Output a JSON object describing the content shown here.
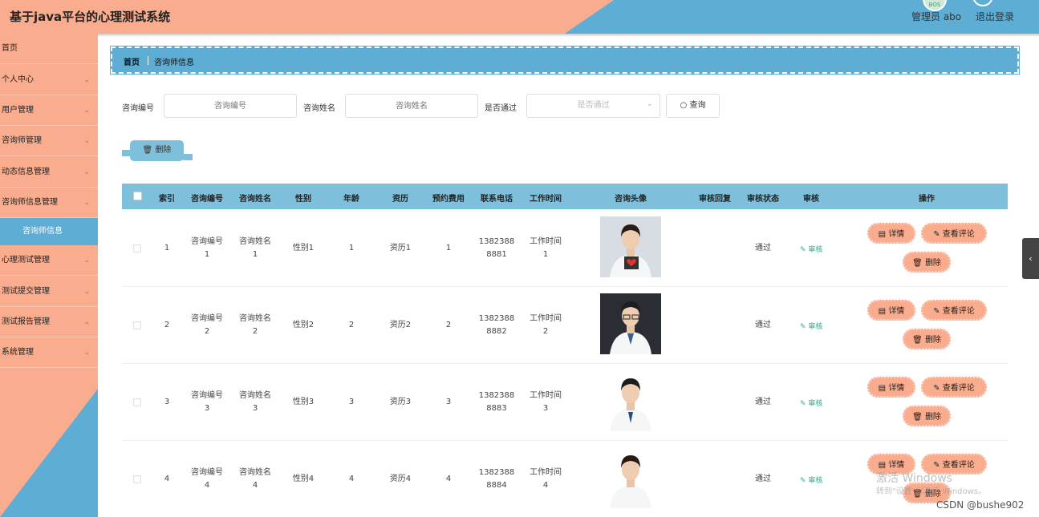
{
  "header": {
    "title": "基于java平台的心理测试系统",
    "avatar_text": "BOS",
    "user": "管理员 abo",
    "logout": "退出登录"
  },
  "sidebar": {
    "items": [
      {
        "label": "首页",
        "expandable": false
      },
      {
        "label": "个人中心",
        "expandable": true
      },
      {
        "label": "用户管理",
        "expandable": true
      },
      {
        "label": "咨询师管理",
        "expandable": true
      },
      {
        "label": "动态信息管理",
        "expandable": true
      },
      {
        "label": "咨询师信息管理",
        "expandable": true
      },
      {
        "label": "心理测试管理",
        "expandable": true
      },
      {
        "label": "测试提交管理",
        "expandable": true
      },
      {
        "label": "测试报告管理",
        "expandable": true
      },
      {
        "label": "系统管理",
        "expandable": true
      }
    ],
    "active_sub": "咨询师信息"
  },
  "breadcrumb": {
    "home": "首页",
    "current": "咨询师信息"
  },
  "search": {
    "code_label": "咨询编号",
    "code_placeholder": "咨询编号",
    "name_label": "咨询姓名",
    "name_placeholder": "咨询姓名",
    "pass_label": "是否通过",
    "pass_placeholder": "是否通过",
    "query_label": "查询"
  },
  "toolbar": {
    "delete_label": "删除"
  },
  "table": {
    "headers": [
      "索引",
      "咨询编号",
      "咨询姓名",
      "性别",
      "年龄",
      "资历",
      "预约费用",
      "联系电话",
      "工作时间",
      "咨询头像",
      "审核回复",
      "审核状态",
      "审核",
      "操作"
    ],
    "audit_label": "审核",
    "op_detail": "详情",
    "op_comments": "查看评论",
    "op_delete": "删除",
    "rows": [
      {
        "index": "1",
        "code": [
          "咨询编号",
          "1"
        ],
        "name": [
          "咨询姓名",
          "1"
        ],
        "gender": "性别1",
        "age": "1",
        "qualification": "资历1",
        "fee": "1",
        "phone": [
          "1382388",
          "8881"
        ],
        "worktime": [
          "工作时间",
          "1"
        ],
        "reply": "",
        "status": "通过",
        "avatar": "female-doctor-tablet"
      },
      {
        "index": "2",
        "code": [
          "咨询编号",
          "2"
        ],
        "name": [
          "咨询姓名",
          "2"
        ],
        "gender": "性别2",
        "age": "2",
        "qualification": "资历2",
        "fee": "2",
        "phone": [
          "1382388",
          "8882"
        ],
        "worktime": [
          "工作时间",
          "2"
        ],
        "reply": "",
        "status": "通过",
        "avatar": "male-doctor-glasses"
      },
      {
        "index": "3",
        "code": [
          "咨询编号",
          "3"
        ],
        "name": [
          "咨询姓名",
          "3"
        ],
        "gender": "性别3",
        "age": "3",
        "qualification": "资历3",
        "fee": "3",
        "phone": [
          "1382388",
          "8883"
        ],
        "worktime": [
          "工作时间",
          "3"
        ],
        "reply": "",
        "status": "通过",
        "avatar": "male-doctor"
      },
      {
        "index": "4",
        "code": [
          "咨询编号",
          "4"
        ],
        "name": [
          "咨询姓名",
          "4"
        ],
        "gender": "性别4",
        "age": "4",
        "qualification": "资历4",
        "fee": "4",
        "phone": [
          "1382388",
          "8884"
        ],
        "worktime": [
          "工作时间",
          "4"
        ],
        "reply": "",
        "status": "通过",
        "avatar": "female-doctor"
      }
    ]
  },
  "watermark": {
    "line1": "激活 Windows",
    "line2": "转到\"设置\"以激活 Windows。"
  },
  "credit": "CSDN @bushe902",
  "colors": {
    "orange": "#f9ad8e",
    "blue": "#5eadd4",
    "table_head": "#7ebfdb",
    "audit_green": "#3aa88a"
  }
}
